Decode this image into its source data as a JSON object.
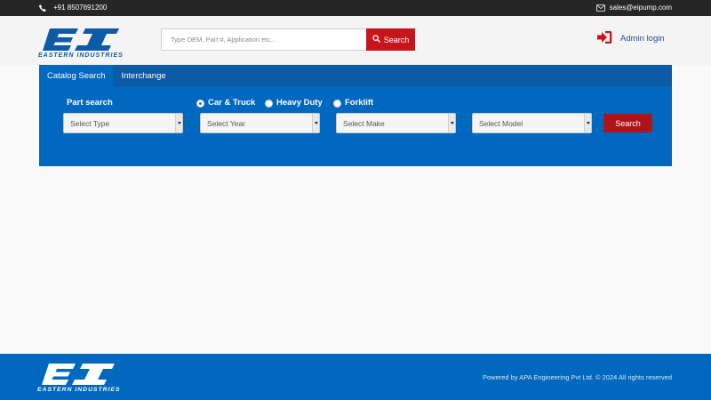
{
  "topbar": {
    "phone": "+91 8507691200",
    "email": "sales@eipump.com",
    "phone_icon": "phone-icon",
    "email_icon": "envelope-icon"
  },
  "header": {
    "logo": {
      "letters": "EI",
      "tagline": "EASTERN INDUSTRIES"
    },
    "search": {
      "placeholder": "Type OEM, Part #, Application etc...",
      "value": "",
      "button_label": "Search",
      "button_icon": "search-icon"
    },
    "admin": {
      "label": "Admin login",
      "icon": "sign-in-icon"
    }
  },
  "panel": {
    "tabs": [
      {
        "label": "Catalog Search",
        "active": true
      },
      {
        "label": "Interchange",
        "active": false
      }
    ],
    "part_search_label": "Part search",
    "radios": [
      {
        "label": "Car & Truck",
        "checked": true
      },
      {
        "label": "Heavy Duty",
        "checked": false
      },
      {
        "label": "Forklift",
        "checked": false
      }
    ],
    "selects": [
      {
        "value": "Select Type"
      },
      {
        "value": "Select Year"
      },
      {
        "value": "Select Make"
      },
      {
        "value": "Select Model"
      }
    ],
    "search_button_label": "Search"
  },
  "footer": {
    "logo": {
      "letters": "EI",
      "tagline": "EASTERN INDUSTRIES"
    },
    "copyright": "Powered by APA Engineering Pvt Ltd. © 2024 All rights reserved"
  },
  "colors": {
    "brand_blue": "#0068bf",
    "brand_red": "#c8151b",
    "topbar": "#262626"
  }
}
